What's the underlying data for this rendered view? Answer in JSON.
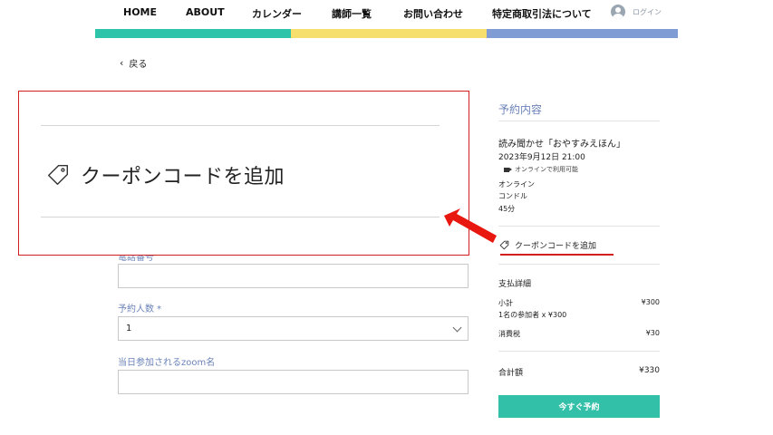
{
  "nav": {
    "items": [
      "HOME",
      "ABOUT",
      "カレンダー",
      "講師一覧",
      "お問い合わせ",
      "特定商取引法について"
    ],
    "login": "ログイン"
  },
  "colors": {
    "stripe1": "#2ec4a9",
    "stripe2": "#f7df6e",
    "stripe3": "#7f9cd4",
    "accent": "#33c0a8",
    "label": "#6b83b8",
    "highlight": "#d21e1e"
  },
  "back": {
    "label": "戻る"
  },
  "form": {
    "phone_label": "電話番号",
    "count_label": "予約人数 *",
    "count_value": "1",
    "zoom_label": "当日参加されるzoom名"
  },
  "zoom": {
    "coupon_label": "クーポンコードを追加"
  },
  "summary": {
    "title": "予約内容",
    "event_name": "読み聞かせ「おやすみえほん」",
    "datetime": "2023年9月12日 21:00",
    "online_badge": "オンラインで利用可能",
    "mode": "オンライン",
    "staff": "コンドル",
    "duration": "45分",
    "coupon_label": "クーポンコードを追加",
    "payment_title": "支払詳細",
    "subtotal_label": "小計",
    "subtotal_value": "¥300",
    "subtotal_note": "1名の参加者 x ¥300",
    "tax_label": "消費税",
    "tax_value": "¥30",
    "total_label": "合計額",
    "total_value": "¥330",
    "book_button": "今すぐ予約"
  }
}
